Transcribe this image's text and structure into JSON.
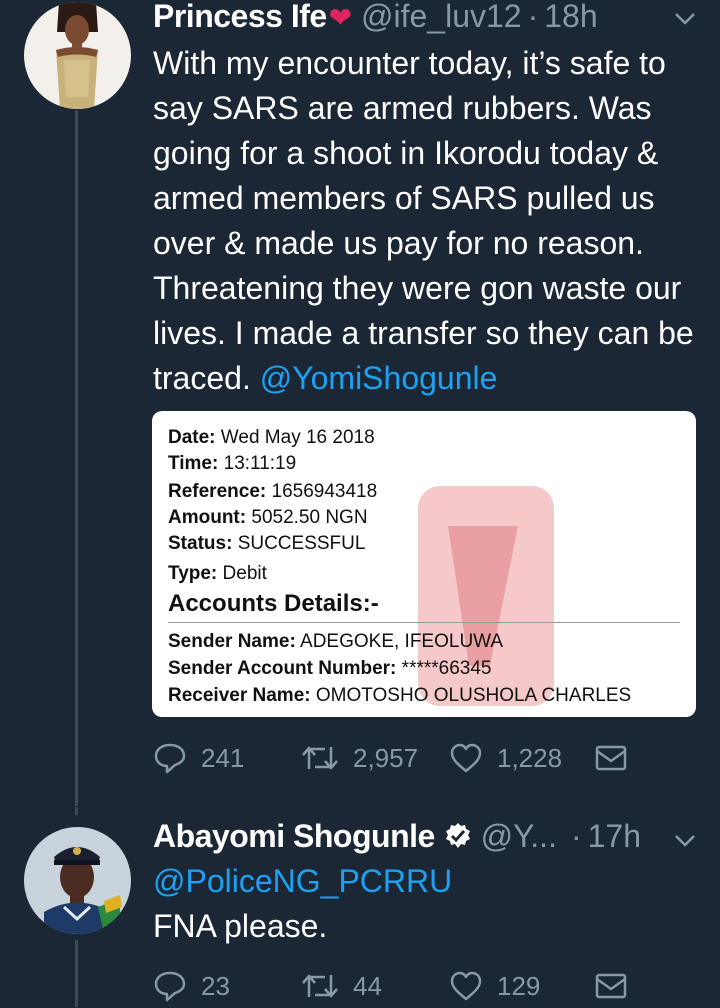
{
  "tweets": [
    {
      "name": "Princess Ife",
      "name_emoji": "❤",
      "handle": "@ife_luv12",
      "separator": "·",
      "time": "18h",
      "text": "With my encounter today, it’s safe to say SARS are armed rubbers. Was going for a shoot in Ikorodu today & armed members of SARS pulled us over & made us pay for no reason. Threatening they were gon waste our lives. I made a transfer so they can be traced.",
      "mention": "@YomiShogunle",
      "attachment": {
        "rows": [
          {
            "label": "Date:",
            "value": "Wed May 16 2018"
          },
          {
            "label": "Time:",
            "value": "13:11:19"
          },
          {
            "label": "Reference:",
            "value": "1656943418"
          },
          {
            "label": "Amount:",
            "value": "5052.50 NGN"
          },
          {
            "label": "Status:",
            "value": "SUCCESSFUL"
          },
          {
            "label": "Type:",
            "value": "Debit"
          }
        ],
        "section_title": "Accounts Details:-",
        "details": [
          {
            "label": "Sender Name:",
            "value": "ADEGOKE, IFEOLUWA"
          },
          {
            "label": "Sender Account Number:",
            "value": "*****66345"
          },
          {
            "label": "Receiver Name:",
            "value": "OMOTOSHO OLUSHOLA CHARLES"
          }
        ]
      },
      "stats": {
        "replies": "241",
        "retweets": "2,957",
        "likes": "1,228"
      }
    },
    {
      "name": "Abayomi Shogunle",
      "handle": "@Y...",
      "separator": "·",
      "time": "17h",
      "mention": "@PoliceNG_PCRRU",
      "text": "FNA please.",
      "stats": {
        "replies": "23",
        "retweets": "44",
        "likes": "129"
      }
    }
  ],
  "icons": {
    "reply": "reply-icon",
    "retweet": "retweet-icon",
    "like": "heart-icon",
    "share": "share-icon",
    "caret": "chevron-down-icon",
    "verified": "verified-badge-icon"
  },
  "colors": {
    "background": "#1b2735",
    "text": "#ffffff",
    "secondary": "#8899a6",
    "link": "#1da1f2",
    "heart_emoji": "#e0245e",
    "thread_line": "#3c4b5a"
  }
}
